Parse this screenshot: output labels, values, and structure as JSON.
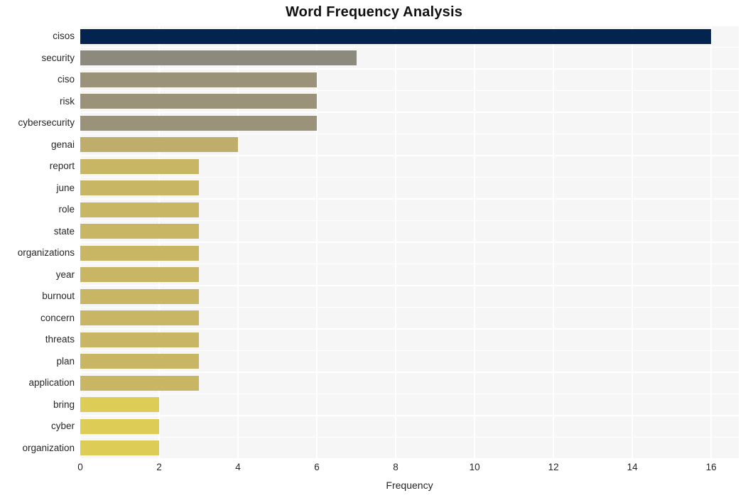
{
  "chart_data": {
    "type": "bar",
    "orientation": "horizontal",
    "title": "Word Frequency Analysis",
    "xlabel": "Frequency",
    "ylabel": "",
    "categories": [
      "cisos",
      "security",
      "ciso",
      "risk",
      "cybersecurity",
      "genai",
      "report",
      "june",
      "role",
      "state",
      "organizations",
      "year",
      "burnout",
      "concern",
      "threats",
      "plan",
      "application",
      "bring",
      "cyber",
      "organization"
    ],
    "values": [
      16,
      7,
      6,
      6,
      6,
      4,
      3,
      3,
      3,
      3,
      3,
      3,
      3,
      3,
      3,
      3,
      3,
      2,
      2,
      2
    ],
    "bar_colors": [
      "#042450",
      "#8c8a7c",
      "#9a9279",
      "#9a9279",
      "#9a9279",
      "#bfae6b",
      "#c9b665",
      "#c9b665",
      "#c9b665",
      "#c9b665",
      "#c9b665",
      "#c9b665",
      "#c9b665",
      "#c9b665",
      "#c9b665",
      "#c9b665",
      "#c9b665",
      "#ddcc55",
      "#ddcc55",
      "#ddcc55"
    ],
    "xlim": [
      0,
      16.7
    ],
    "xticks": [
      0,
      2,
      4,
      6,
      8,
      10,
      12,
      14,
      16
    ],
    "xtick_labels": [
      "0",
      "2",
      "4",
      "6",
      "8",
      "10",
      "12",
      "14",
      "16"
    ],
    "grid": true,
    "grid_color": "#ffffff",
    "plot_background": "#f6f6f6",
    "figure_background": "#ffffff",
    "legend": null,
    "legend_position": "none"
  }
}
